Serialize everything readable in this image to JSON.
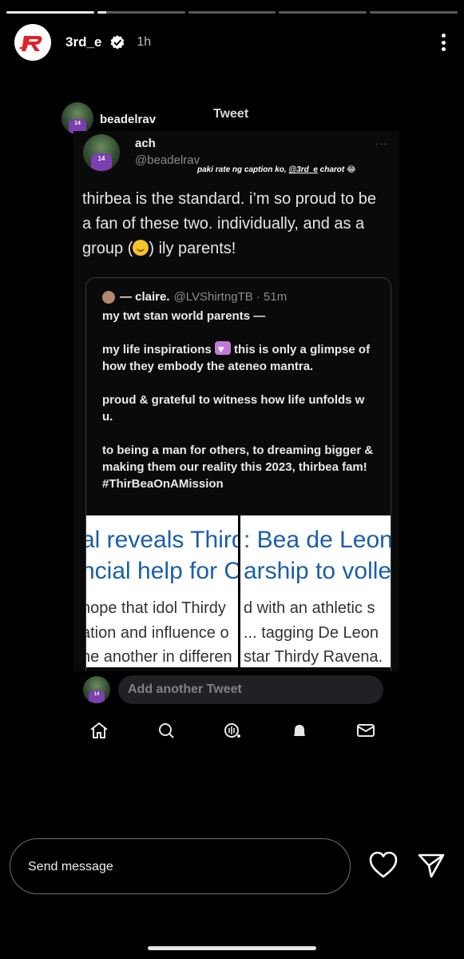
{
  "story": {
    "progress": [
      1,
      0.1,
      0,
      0,
      0
    ],
    "username": "3rd_e",
    "time": "1h"
  },
  "shot": {
    "repost_user": "beadelrav",
    "title": "Tweet",
    "tweet": {
      "name": "ach",
      "handle": "@beadelrav",
      "more": "···",
      "caption_pre": "paki rate ng caption ko, ",
      "caption_mention": "@3rd_e",
      "caption_post": " charot 😂",
      "body_1": "thirbea is the standard. i’m so proud to be a fan of these two. individually, and as a group (",
      "body_2": ") ily parents!"
    },
    "quote": {
      "name": "— claire.",
      "meta": "@LVShirtngTB · 51m",
      "p1": "my twt stan world parents —",
      "p2a": "my life inspirations ",
      "p2b": " this is only a glimpse of how they embody the ateneo mantra.",
      "p3": "proud & grateful to witness how life unfolds w u.",
      "p4": "to being a man for others, to dreaming bigger & making them our reality this 2023, thirbea fam!",
      "p5": "#ThirBeaOnAMission",
      "img1": {
        "h1": "al reveals Third",
        "h2": "ncial help for C",
        "b1": "hope that idol Thirdy",
        "b2": "ation and influence o",
        "b3": "ne another in differen"
      },
      "img2": {
        "h1": ": Bea de Leon",
        "h2": "arship to volle",
        "b1": "d with an athletic s",
        "b2": "... tagging De Leon",
        "b3": "star Thirdy Ravena."
      }
    },
    "add_placeholder": "Add another Tweet"
  },
  "message": {
    "placeholder": "Send message"
  },
  "colors": {
    "accent_red": "#e0202b",
    "link_blue": "#1a5fa8"
  }
}
